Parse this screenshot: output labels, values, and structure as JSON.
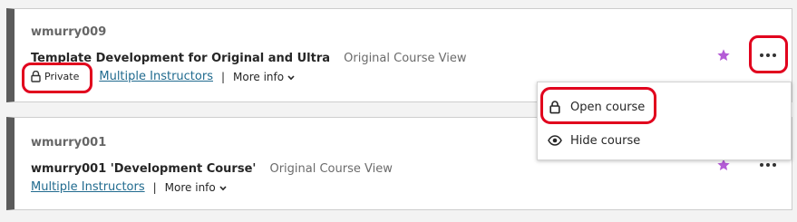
{
  "courses": [
    {
      "id": "wmurry009",
      "title": "Template Development for Original and Ultra",
      "view": "Original Course View",
      "badge": "Private",
      "instructors": "Multiple Instructors",
      "separator": "|",
      "more_info": "More info",
      "favorite": true
    },
    {
      "id": "wmurry001",
      "title": "wmurry001 'Development Course'",
      "view": "Original Course View",
      "instructors": "Multiple Instructors",
      "separator": "|",
      "more_info": "More info",
      "favorite": true
    }
  ],
  "menu": {
    "items": [
      {
        "label": "Open course",
        "icon": "lock-icon"
      },
      {
        "label": "Hide course",
        "icon": "eye-icon"
      }
    ]
  },
  "colors": {
    "accent_star": "#b45cd6",
    "link": "#216b8f",
    "highlight_ring": "#e1001d",
    "card_stripe": "#5b5b5b"
  }
}
